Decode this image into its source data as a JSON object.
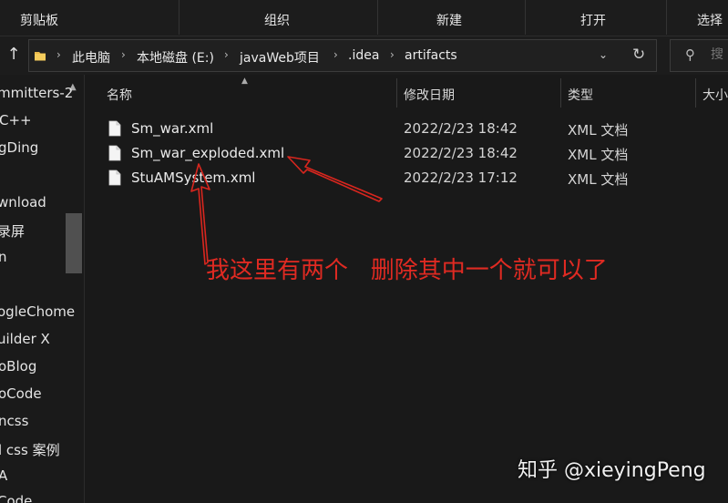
{
  "ribbon": {
    "groups": [
      "剪贴板",
      "组织",
      "新建",
      "打开",
      "选择"
    ]
  },
  "address": {
    "crumbs": [
      "此电脑",
      "本地磁盘 (E:)",
      "javaWeb项目",
      ".idea",
      "artifacts"
    ],
    "search_placeholder": "搜"
  },
  "nav": {
    "items": [
      "mmitters-2",
      "C++",
      "gDing",
      "wnload",
      "录屏",
      "n",
      "ogleChome",
      "uilder X",
      "oBlog",
      "oCode",
      "ncss",
      "l css 案例",
      "A",
      "Code"
    ]
  },
  "columns": {
    "name": "名称",
    "date": "修改日期",
    "type": "类型",
    "size": "大小"
  },
  "files": [
    {
      "name": "Sm_war.xml",
      "date": "2022/2/23 18:42",
      "type": "XML 文档"
    },
    {
      "name": "Sm_war_exploded.xml",
      "date": "2022/2/23 18:42",
      "type": "XML 文档"
    },
    {
      "name": "StuAMSystem.xml",
      "date": "2022/2/23 17:12",
      "type": "XML 文档"
    }
  ],
  "annotation": {
    "text": "我这里有两个   删除其中一个就可以了",
    "color": "#e02a22"
  },
  "watermark": "知乎 @xieyingPeng",
  "icons": {
    "up": "arrow-up-icon",
    "folder": "folder-icon",
    "breadcrumb_sep": "chevron-right-icon",
    "dropdown": "chevron-down-icon",
    "refresh": "refresh-icon",
    "search": "search-icon",
    "file": "file-icon"
  }
}
